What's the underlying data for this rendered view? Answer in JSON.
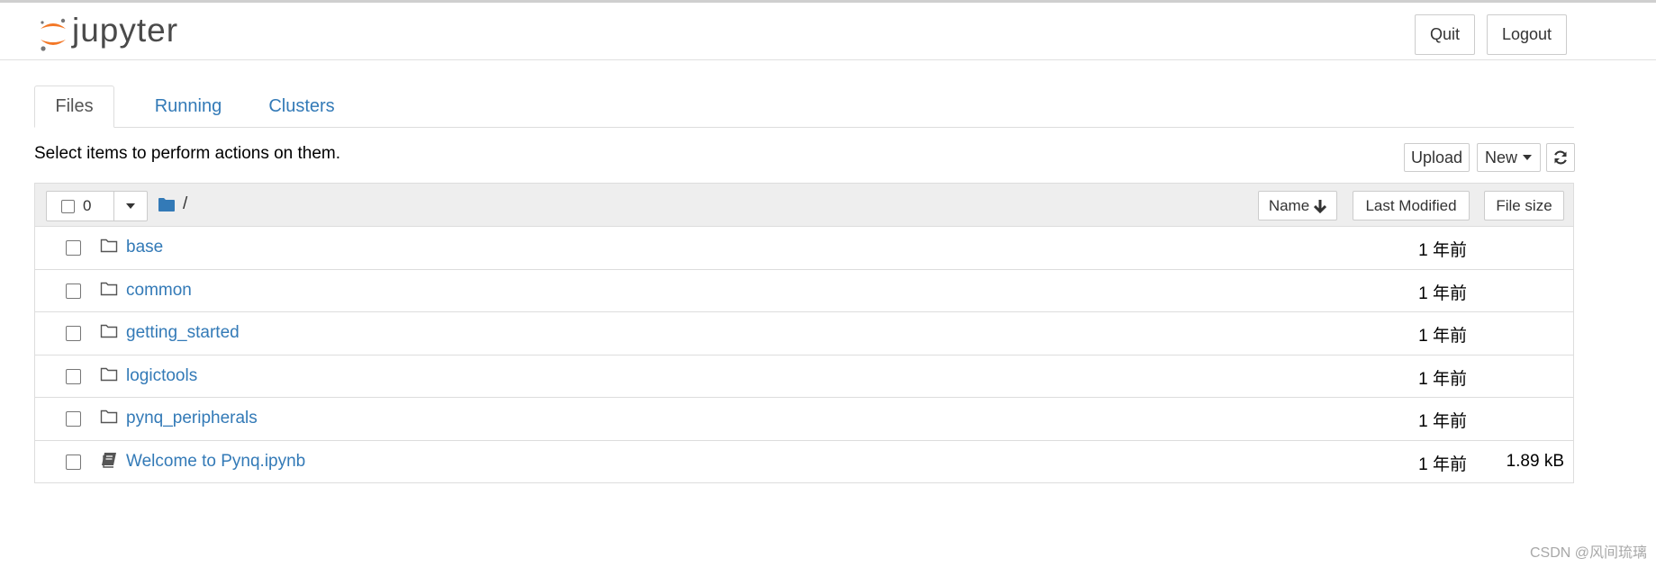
{
  "header": {
    "logo_text": "jupyter",
    "quit_label": "Quit",
    "logout_label": "Logout"
  },
  "tabs": [
    {
      "label": "Files",
      "active": true
    },
    {
      "label": "Running",
      "active": false
    },
    {
      "label": "Clusters",
      "active": false
    }
  ],
  "toolbar": {
    "hint": "Select items to perform actions on them.",
    "upload_label": "Upload",
    "new_label": "New"
  },
  "list_header": {
    "selected_count": "0",
    "path": "/",
    "name_label": "Name",
    "modified_label": "Last Modified",
    "size_label": "File size"
  },
  "files": [
    {
      "name": "base",
      "type": "folder",
      "modified": "1 年前",
      "size": ""
    },
    {
      "name": "common",
      "type": "folder",
      "modified": "1 年前",
      "size": ""
    },
    {
      "name": "getting_started",
      "type": "folder",
      "modified": "1 年前",
      "size": ""
    },
    {
      "name": "logictools",
      "type": "folder",
      "modified": "1 年前",
      "size": ""
    },
    {
      "name": "pynq_peripherals",
      "type": "folder",
      "modified": "1 年前",
      "size": ""
    },
    {
      "name": "Welcome to Pynq.ipynb",
      "type": "notebook",
      "modified": "1 年前",
      "size": "1.89 kB"
    }
  ],
  "watermark": "CSDN @风间琉璃",
  "colors": {
    "link": "#337ab7",
    "logo_orange": "#f37726",
    "header_bg": "#eeeeee"
  }
}
